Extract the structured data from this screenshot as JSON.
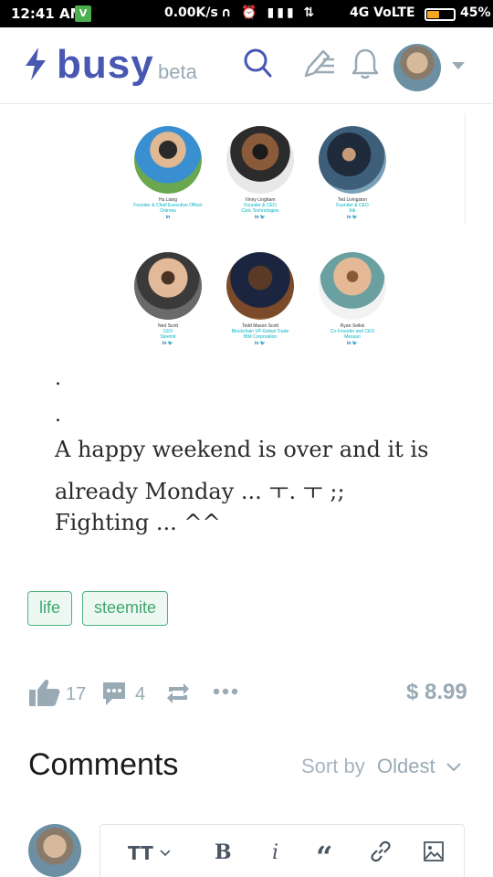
{
  "status_bar": {
    "time": "12:41 AM",
    "app_icon": "V",
    "speed": "0.00K/s",
    "network": "4G VoLTE",
    "battery": "45%",
    "battery_level": 0.45
  },
  "header": {
    "logo": "busy",
    "beta": "beta",
    "icons": [
      "search-icon",
      "write-icon",
      "bell-icon"
    ]
  },
  "team": {
    "members": [
      {
        "name": "Hu Liang",
        "role": "Founder & Chief Executive Officer",
        "org": "Ontrees",
        "social": "in"
      },
      {
        "name": "Vinny Lingham",
        "role": "Founder & CEO",
        "org": "Civic Technologies",
        "social": "in 🐦"
      },
      {
        "name": "Ted Livingston",
        "role": "Founder & CEO",
        "org": "Kik",
        "social": "in 🐦"
      },
      {
        "name": "Ned Scott",
        "role": "CEO",
        "org": "Steemit",
        "social": "in 🐦"
      },
      {
        "name": "Todd Mason Scott",
        "role": "Blockchain VP-Global Trade",
        "org": "IBM Corporation",
        "social": "in 🐦"
      },
      {
        "name": "Ryan Selkis",
        "role": "Co-Founder and CEO",
        "org": "Messari",
        "social": "in 🐦"
      }
    ]
  },
  "post": {
    "dot1": ".",
    "dot2": ".",
    "line1": "A happy weekend is over and it is",
    "line2": "already Monday ... ㅜ. ㅜ ;;",
    "line3": "Fighting ... ^^"
  },
  "tags": [
    "life",
    "steemite"
  ],
  "actions": {
    "likes": "17",
    "comments": "4",
    "payout": "$ 8.99"
  },
  "comments": {
    "title": "Comments",
    "sort_label": "Sort by",
    "sort_value": "Oldest"
  },
  "editor": {
    "tools": [
      "text-size-icon",
      "bold-icon",
      "italic-icon",
      "quote-icon",
      "link-icon",
      "image-icon"
    ]
  },
  "colors": {
    "brand": "#4757b2",
    "muted": "#99aab5",
    "tag_green": "#4db37e"
  }
}
